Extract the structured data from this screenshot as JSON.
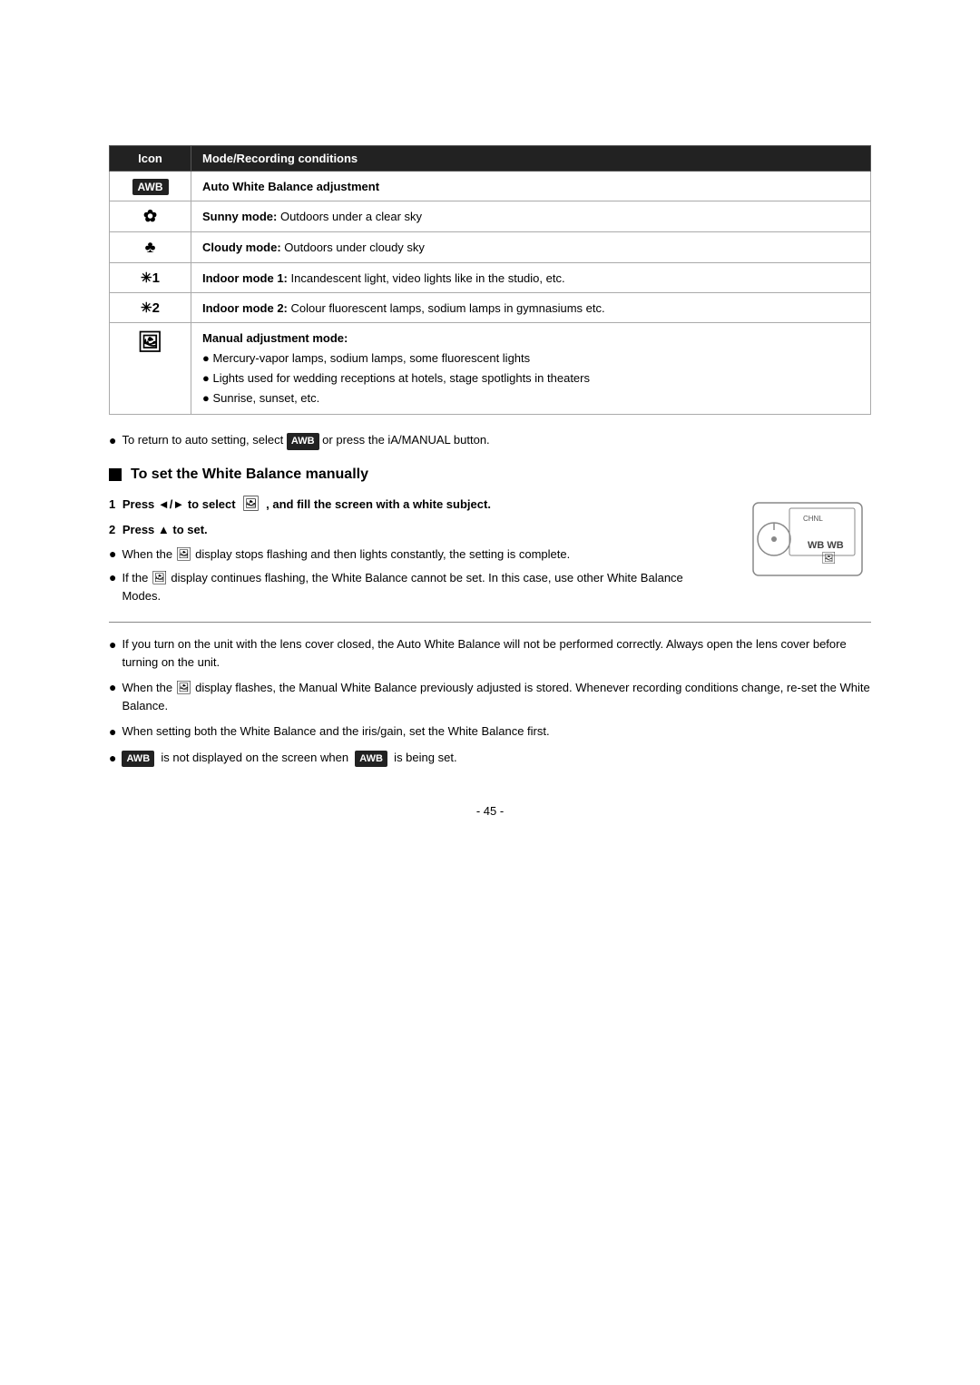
{
  "table": {
    "col1_header": "Icon",
    "col2_header": "Mode/Recording conditions",
    "rows": [
      {
        "icon": "AWB",
        "icon_type": "badge",
        "description": "Auto White Balance adjustment",
        "description_bold": true
      },
      {
        "icon": "☀",
        "icon_type": "symbol",
        "description_bold_part": "Sunny mode:",
        "description_rest": " Outdoors under a clear sky"
      },
      {
        "icon": "☁",
        "icon_type": "symbol",
        "description_bold_part": "Cloudy mode:",
        "description_rest": " Outdoors under cloudy sky"
      },
      {
        "icon": "✳1",
        "icon_type": "text",
        "description_bold_part": "Indoor mode 1:",
        "description_rest": " Incandescent light, video lights like in the studio, etc."
      },
      {
        "icon": "✳2",
        "icon_type": "text",
        "description_bold_part": "Indoor mode 2:",
        "description_rest": " Colour fluorescent lamps, sodium lamps in gymnasiums etc."
      },
      {
        "icon": "▲",
        "icon_type": "manual",
        "mode_title": "Manual adjustment mode:",
        "bullets": [
          "Mercury-vapor lamps, sodium lamps, some fluorescent lights",
          "Lights used for wedding receptions at hotels, stage spotlights in theaters",
          "Sunrise, sunset, etc."
        ]
      }
    ]
  },
  "auto_note": "To return to auto setting, select",
  "auto_note_mid": "AWB",
  "auto_note_end": "or press the iA/MANUAL button.",
  "section_title": "To set the White Balance manually",
  "step1": {
    "number": "1",
    "text_bold": "Press ◄/► to select",
    "icon": "▲",
    "text_bold2": ", and fill the screen with a white subject."
  },
  "step2": {
    "number": "2",
    "text_bold": "Press ▲ to set."
  },
  "step_bullets": [
    "When the  display stops flashing and then lights constantly, the setting is complete.",
    "If the  display continues flashing, the White Balance cannot be set. In this case, use other White Balance Modes."
  ],
  "bottom_notes": [
    "If you turn on the unit with the lens cover closed, the Auto White Balance will not be performed correctly. Always open the lens cover before turning on the unit.",
    "When the  display flashes, the Manual White Balance previously adjusted is stored. Whenever recording conditions change, re-set the White Balance.",
    "When setting both the White Balance and the iris/gain, set the White Balance first.",
    "AWB  is not displayed on the screen when  AWB  is being set."
  ],
  "page_number": "- 45 -"
}
